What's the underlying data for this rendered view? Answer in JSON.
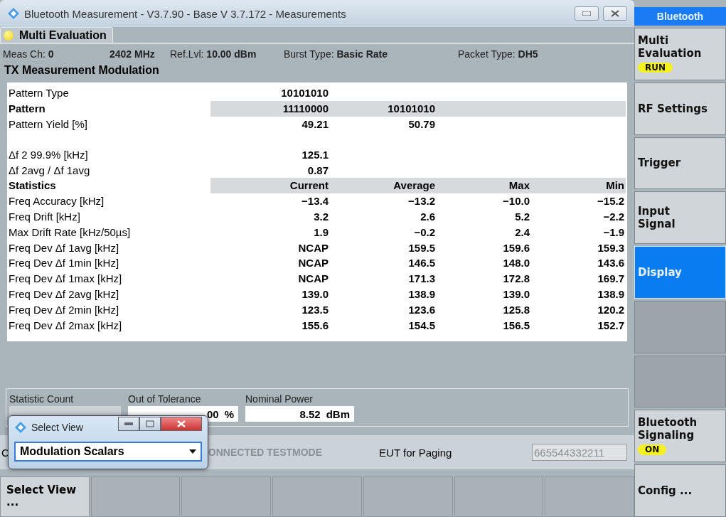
{
  "window": {
    "title": "Bluetooth Measurement  - V3.7.90 - Base V 3.7.172 - Measurements"
  },
  "tab": {
    "label": "Multi Evaluation"
  },
  "info": [
    {
      "label": "Meas Ch:",
      "value": "0"
    },
    {
      "value": "2402 MHz"
    },
    {
      "label": "Ref.Lvl:",
      "value": "10.00 dBm"
    },
    {
      "label": "Burst Type:",
      "value": "Basic Rate"
    },
    {
      "label": "Packet Type:",
      "value": "DH5"
    }
  ],
  "heading": "TX Measurement Modulation",
  "table": {
    "rows": [
      {
        "kind": "data",
        "label": "Pattern Type",
        "cells": [
          "10101010"
        ]
      },
      {
        "kind": "header",
        "label": "Pattern",
        "cells": [
          "11110000",
          "10101010"
        ]
      },
      {
        "kind": "data",
        "label": "Pattern Yield [%]",
        "cells": [
          "49.21",
          "50.79"
        ]
      },
      {
        "kind": "gap",
        "label": "Δf 2 99.9% [kHz]",
        "cells": [
          "125.1"
        ]
      },
      {
        "kind": "data",
        "label": "Δf 2avg / Δf 1avg",
        "cells": [
          "0.87"
        ]
      },
      {
        "kind": "header",
        "label": "Statistics",
        "cells": [
          "Current",
          "Average",
          "Max",
          "Min"
        ]
      },
      {
        "kind": "data",
        "label": "Freq Accuracy [kHz]",
        "cells": [
          "−13.4",
          "−13.2",
          "−10.0",
          "−15.2"
        ]
      },
      {
        "kind": "data",
        "label": "Freq Drift [kHz]",
        "cells": [
          "3.2",
          "2.6",
          "5.2",
          "−2.2"
        ]
      },
      {
        "kind": "data",
        "label": "Max Drift Rate [kHz/50µs]",
        "cells": [
          "1.9",
          "−0.2",
          "2.4",
          "−1.9"
        ]
      },
      {
        "kind": "data",
        "label": "Freq Dev Δf 1avg [kHz]",
        "cells": [
          "NCAP",
          "159.5",
          "159.6",
          "159.3"
        ]
      },
      {
        "kind": "data",
        "label": "Freq Dev Δf 1min [kHz]",
        "cells": [
          "NCAP",
          "146.5",
          "148.0",
          "143.6"
        ]
      },
      {
        "kind": "data",
        "label": "Freq Dev Δf 1max [kHz]",
        "cells": [
          "NCAP",
          "171.3",
          "172.8",
          "169.7"
        ]
      },
      {
        "kind": "data",
        "label": "Freq Dev Δf 2avg [kHz]",
        "cells": [
          "139.0",
          "138.9",
          "139.0",
          "138.9"
        ]
      },
      {
        "kind": "data",
        "label": "Freq Dev Δf 2min [kHz]",
        "cells": [
          "123.5",
          "123.6",
          "125.8",
          "120.2"
        ]
      },
      {
        "kind": "data",
        "label": "Freq Dev Δf 2max [kHz]",
        "cells": [
          "155.6",
          "154.5",
          "156.5",
          "152.7"
        ]
      }
    ]
  },
  "stats": {
    "statistic_count": {
      "label": "Statistic Count"
    },
    "out_of_tolerance": {
      "label": "Out of Tolerance",
      "value": "00",
      "unit": "%"
    },
    "nominal_power": {
      "label": "Nominal Power",
      "value": "8.52",
      "unit": "dBm"
    }
  },
  "signaling": {
    "label_1": "C",
    "label_2": "ONNECTED TESTMODE",
    "eut_label": "EUT for Paging",
    "eut_value": "665544332211"
  },
  "dialog": {
    "title": "Select View",
    "value": "Modulation Scalars"
  },
  "softkeys": [
    {
      "kind": "button",
      "label": "Select View ..."
    },
    {
      "kind": "blank"
    },
    {
      "kind": "blank"
    },
    {
      "kind": "blank"
    },
    {
      "kind": "blank"
    },
    {
      "kind": "blank"
    },
    {
      "kind": "blank"
    }
  ],
  "sidebar": {
    "title": "Bluetooth",
    "items": [
      {
        "label": "Multi Evaluation",
        "badge": "RUN",
        "selected": false
      },
      {
        "label": "RF Settings",
        "selected": false
      },
      {
        "label": "Trigger",
        "selected": false
      },
      {
        "label": "Input Signal",
        "selected": false
      },
      {
        "label": "Display",
        "selected": true
      },
      {
        "kind": "blank",
        "selected": false
      },
      {
        "kind": "blank",
        "selected": false
      },
      {
        "label": "Bluetooth Signaling",
        "badge": "ON",
        "selected": false
      },
      {
        "label": "Config ...",
        "selected": false
      }
    ]
  }
}
